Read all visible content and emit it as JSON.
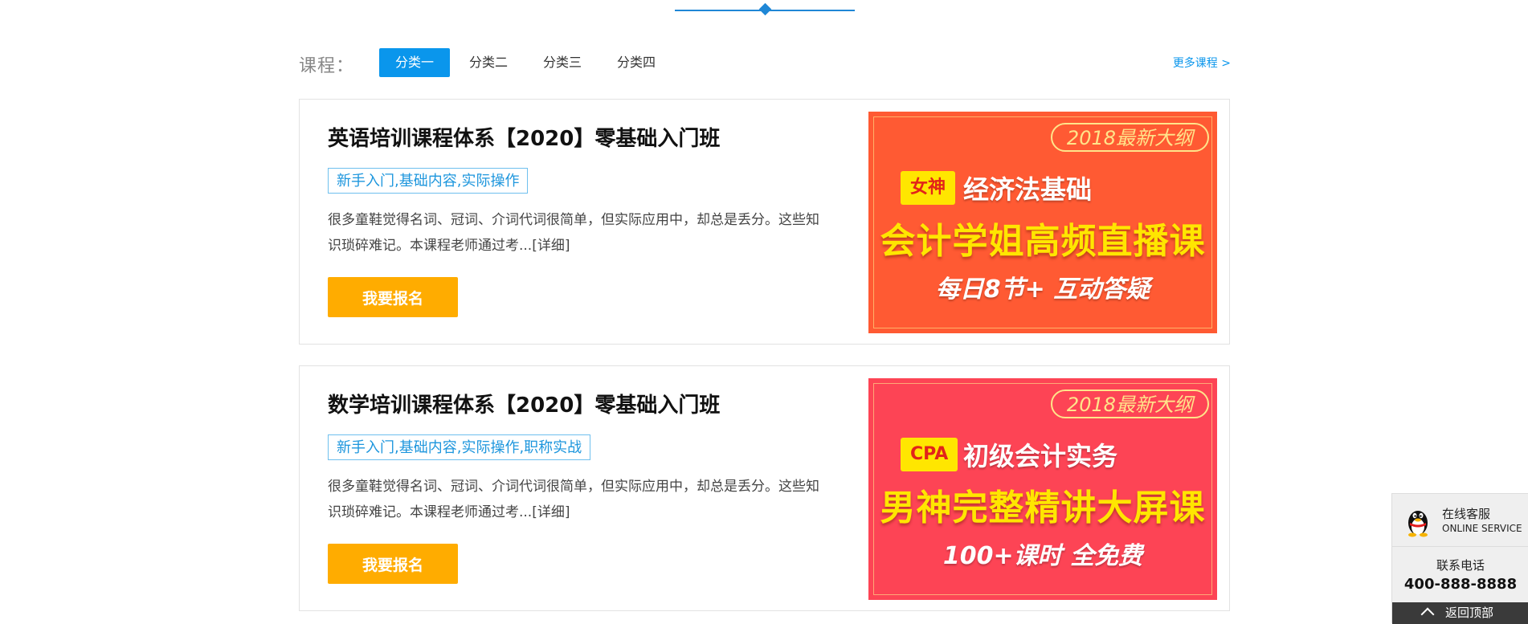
{
  "category": {
    "title": "课程：",
    "tabs": [
      "分类一",
      "分类二",
      "分类三",
      "分类四"
    ],
    "active_tab_index": 0,
    "more_link": "更多课程 >"
  },
  "courses": [
    {
      "title": "英语培训课程体系【2020】零基础入门班",
      "tags": "新手入门,基础内容,实际操作",
      "description": "很多童鞋觉得名词、冠词、介词代词很简单，但实际应用中，却总是丢分。这些知识琐碎难记。本课程老师通过考...[详细]",
      "signup_label": "我要报名",
      "banner": {
        "pill": "2018最新大纲",
        "badge": "女神",
        "subtitle": "经济法基础",
        "headline": "会计学姐高频直播课",
        "tagline": "每日8节+ 互动答疑",
        "color": "#ff5a33"
      }
    },
    {
      "title": "数学培训课程体系【2020】零基础入门班",
      "tags": "新手入门,基础内容,实际操作,职称实战",
      "description": "很多童鞋觉得名词、冠词、介词代词很简单，但实际应用中，却总是丢分。这些知识琐碎难记。本课程老师通过考...[详细]",
      "signup_label": "我要报名",
      "banner": {
        "pill": "2018最新大纲",
        "badge": "CPA",
        "subtitle": "初级会计实务",
        "headline": "男神完整精讲大屏课",
        "tagline": "100+课时 全免费",
        "color": "#fd4455"
      }
    }
  ],
  "service": {
    "online_label": "在线客服",
    "online_label_en": "ONLINE SERVICE",
    "phone_label": "联系电话",
    "phone_number": "400-888-8888",
    "back_to_top": "返回顶部",
    "icon": "qq-penguin-icon"
  },
  "colors": {
    "accent_blue": "#0a96ec",
    "signup_orange": "#ffac00"
  }
}
